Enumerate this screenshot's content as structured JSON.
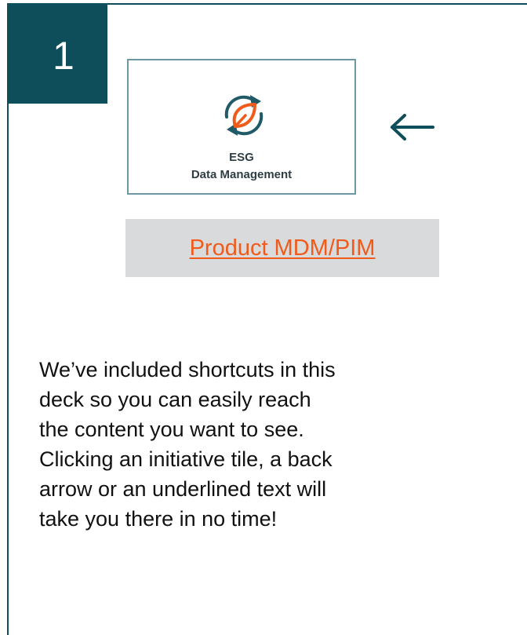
{
  "step": {
    "number": "1"
  },
  "tile": {
    "icon": "leaf-recycle-icon",
    "line1": "ESG",
    "line2": "Data Management"
  },
  "back_arrow": {
    "icon": "arrow-left-icon"
  },
  "link": {
    "label": "Product MDM/PIM"
  },
  "description": {
    "lines": [
      "We’ve included shortcuts in this",
      "deck so you can easily reach",
      "the content you want to see.",
      "Clicking an initiative tile, a back",
      "arrow or an underlined text will",
      "take you there in no time!"
    ]
  },
  "colors": {
    "frame": "#0e4d5a",
    "tile_border": "#6d98a3",
    "icon_teal": "#1f5a66",
    "icon_orange": "#f05a1a",
    "link": "#f05a1a",
    "link_box": "#d9dadb"
  }
}
